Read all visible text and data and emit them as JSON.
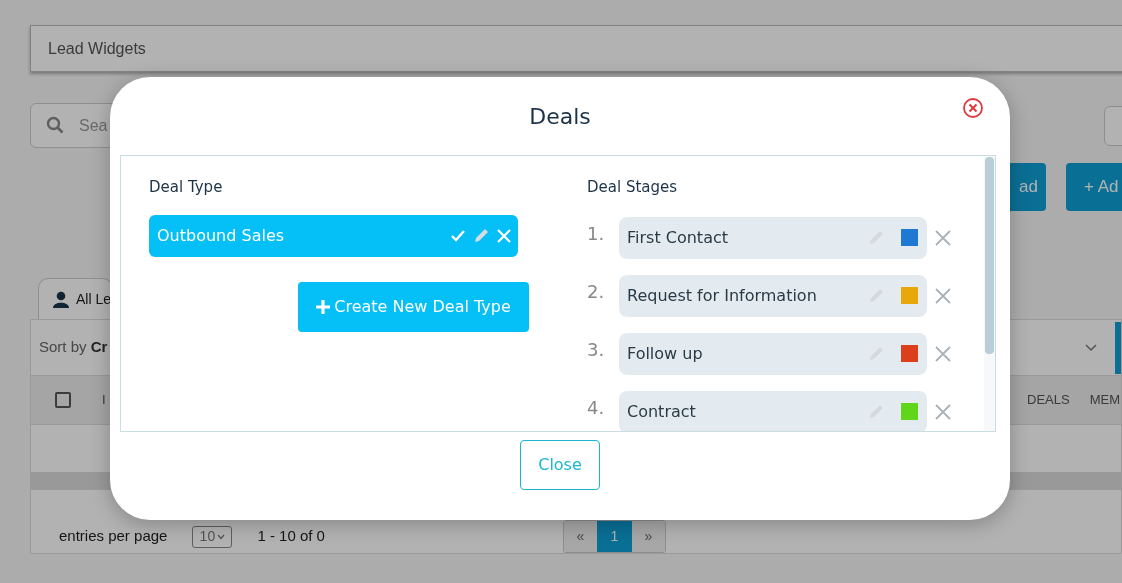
{
  "page": {
    "widget_bar": {
      "label": "Lead Widgets"
    },
    "search": {
      "placeholder": "Sea"
    },
    "buttons": [
      "ad",
      "+ Ad"
    ],
    "tabs": [
      {
        "label": "All Le",
        "selected": true
      }
    ],
    "sort": {
      "label": "Sort by",
      "value": "Cr"
    },
    "table": {
      "select_all_checked": false,
      "columns": [
        "I",
        "DEALS",
        "MEM"
      ]
    },
    "footer": {
      "entries_label": "entries per page",
      "page_size": "10",
      "range": "1 - 10 of 0",
      "pages": [
        {
          "label": "«",
          "selected": false
        },
        {
          "label": "1",
          "selected": true
        },
        {
          "label": "»",
          "selected": false
        }
      ]
    }
  },
  "modal": {
    "title": "Deals",
    "deal_type": {
      "heading": "Deal Type",
      "types": [
        {
          "name": "Outbound Sales"
        }
      ],
      "create_button": "Create New Deal Type"
    },
    "deal_stages": {
      "heading": "Deal Stages",
      "stages": [
        {
          "number": "1.",
          "name": "First Contact",
          "color": "#1f78d1"
        },
        {
          "number": "2.",
          "name": "Request for Information",
          "color": "#e8a80c"
        },
        {
          "number": "3.",
          "name": "Follow up",
          "color": "#dc3f1c"
        },
        {
          "number": "4.",
          "name": "Contract",
          "color": "#5fd61a"
        }
      ]
    },
    "close_button": "Close"
  }
}
